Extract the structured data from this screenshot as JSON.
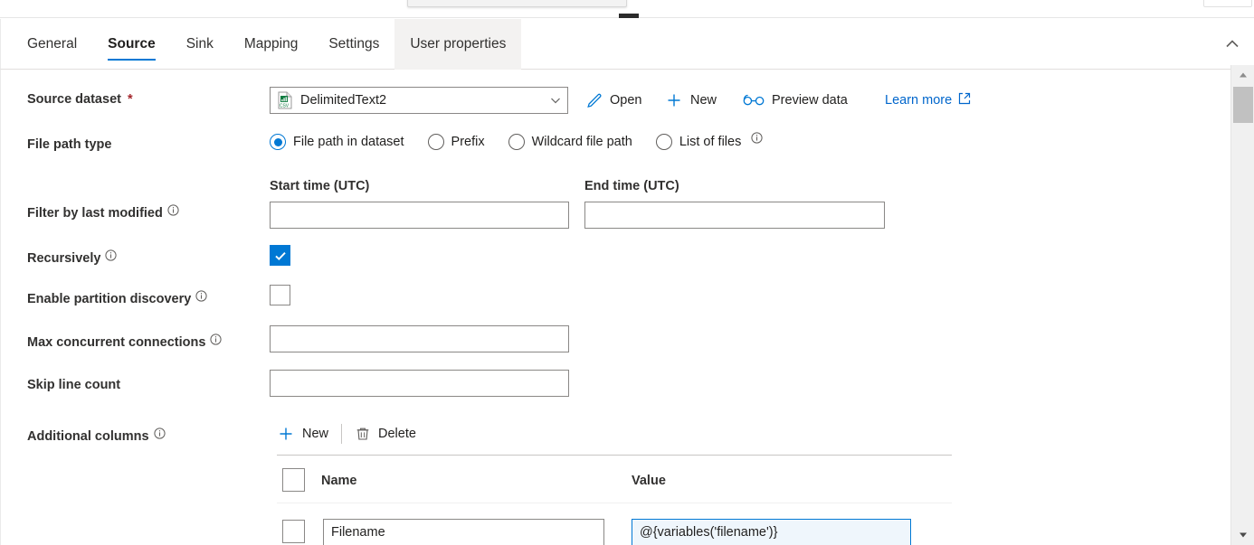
{
  "tabs": [
    {
      "label": "General",
      "state": "normal"
    },
    {
      "label": "Source",
      "state": "active"
    },
    {
      "label": "Sink",
      "state": "normal"
    },
    {
      "label": "Mapping",
      "state": "normal"
    },
    {
      "label": "Settings",
      "state": "normal"
    },
    {
      "label": "User properties",
      "state": "hovered"
    }
  ],
  "collapse_icon": "chevron-up-icon",
  "source_dataset": {
    "label": "Source dataset",
    "required_marker": "*",
    "value": "DelimitedText2",
    "icon": "delimited-text-dataset-icon",
    "caret_icon": "chevron-down-icon",
    "commands": [
      {
        "label": "Open",
        "icon": "pencil-icon"
      },
      {
        "label": "New",
        "icon": "plus-icon"
      },
      {
        "label": "Preview data",
        "icon": "glasses-icon"
      }
    ],
    "learn_more": {
      "label": "Learn more",
      "icon": "external-link-icon"
    }
  },
  "file_path_type": {
    "label": "File path type",
    "options": [
      {
        "label": "File path in dataset",
        "selected": true,
        "info": false
      },
      {
        "label": "Prefix",
        "selected": false,
        "info": false
      },
      {
        "label": "Wildcard file path",
        "selected": false,
        "info": false
      },
      {
        "label": "List of files",
        "selected": false,
        "info": true
      }
    ]
  },
  "filter_by_last_modified": {
    "label": "Filter by last modified",
    "info": true,
    "start": {
      "label": "Start time (UTC)",
      "value": "",
      "placeholder": ""
    },
    "end": {
      "label": "End time (UTC)",
      "value": "",
      "placeholder": ""
    }
  },
  "recursively": {
    "label": "Recursively",
    "info": true,
    "checked": true
  },
  "enable_partition_discovery": {
    "label": "Enable partition discovery",
    "info": true,
    "checked": false
  },
  "max_concurrent_connections": {
    "label": "Max concurrent connections",
    "info": true,
    "value": "",
    "placeholder": ""
  },
  "skip_line_count": {
    "label": "Skip line count",
    "info": false,
    "value": "",
    "placeholder": ""
  },
  "additional_columns": {
    "label": "Additional columns",
    "info": true,
    "toolbar": [
      {
        "label": "New",
        "icon": "plus-icon"
      },
      {
        "label": "Delete",
        "icon": "trash-icon"
      }
    ],
    "columns": [
      "Name",
      "Value"
    ],
    "select_all_checked": false,
    "rows": [
      {
        "selected": false,
        "name": {
          "value": "Filename",
          "focused": false
        },
        "value": {
          "value": "@{variables('filename')}",
          "focused": true
        }
      }
    ]
  },
  "scrollbars": {
    "vertical": {
      "up_icon": "caret-up-icon",
      "down_icon": "caret-down-icon"
    },
    "horizontal": {}
  },
  "colors": {
    "accent": "#0078d4",
    "link": "#0066cc",
    "required": "#a4262c",
    "field_border": "#8a8886",
    "focus_fill": "#eff6fc",
    "tab_hover": "#f3f2f1"
  }
}
